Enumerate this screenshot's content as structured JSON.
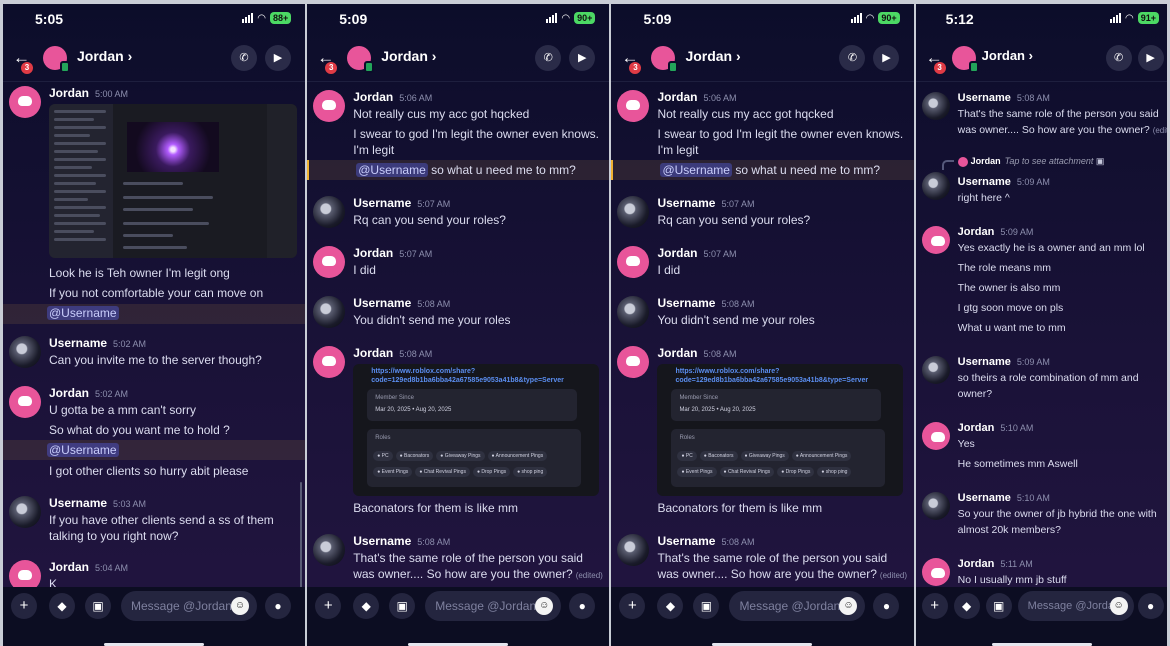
{
  "panels": [
    {
      "status": {
        "time": "5:05",
        "battery": "88+"
      },
      "header": {
        "name": "Jordan",
        "badge": "3"
      },
      "input": {
        "placeholder": "Message @Jordan"
      },
      "messages": [
        {
          "user": "Jordan",
          "time": "5:00 AM",
          "lines": [
            "Look he is Teh owner I'm legit ong",
            "If you not comfortable your can move  on"
          ],
          "mention": "@Username"
        },
        {
          "user": "Username",
          "time": "5:02 AM",
          "lines": [
            "Can you invite me to the server though?"
          ]
        },
        {
          "user": "Jordan",
          "time": "5:02 AM",
          "lines": [
            "U gotta be a mm can't sorry",
            "So what do you want me to hold ?"
          ],
          "mention": "@Username",
          "after": "I got other clients so hurry abit please"
        },
        {
          "user": "Username",
          "time": "5:03 AM",
          "lines": [
            "If you have other clients send a ss of them",
            "talking to you right now?"
          ]
        },
        {
          "user": "Jordan",
          "time": "5:04 AM",
          "lines": [
            "K"
          ]
        }
      ]
    },
    {
      "status": {
        "time": "5:09",
        "battery": "90+"
      },
      "header": {
        "name": "Jordan",
        "badge": "3"
      },
      "input": {
        "placeholder": "Message @Jordan"
      },
      "messages": [
        {
          "user": "Jordan",
          "time": "5:06 AM",
          "lines": [
            "Not really cus my acc got hqcked",
            "I swear to god I'm legit the owner even knows.",
            "I'm legit"
          ],
          "mention": "@Username",
          "mention_tail": " so what u need me to mm?"
        },
        {
          "user": "Username",
          "time": "5:07 AM",
          "lines": [
            "Rq can you send your roles?"
          ]
        },
        {
          "user": "Jordan",
          "time": "5:07 AM",
          "lines": [
            "I did"
          ]
        },
        {
          "user": "Username",
          "time": "5:08 AM",
          "lines": [
            "You didn't send me your roles"
          ]
        },
        {
          "user": "Jordan",
          "time": "5:08 AM",
          "lines": [
            "Baconators for them is like mm"
          ]
        },
        {
          "user": "Username",
          "time": "5:08 AM",
          "lines": [
            "That's the same role of the person you said",
            "was owner.... So how are you the owner?"
          ],
          "edited": "(edited)"
        }
      ]
    },
    {
      "status": {
        "time": "5:09",
        "battery": "90+"
      },
      "header": {
        "name": "Jordan",
        "badge": "3"
      },
      "input": {
        "placeholder": "Message @Jordan"
      },
      "messages": [
        {
          "user": "Jordan",
          "time": "5:06 AM",
          "lines": [
            "Not really cus my acc got hqcked",
            "I swear to god I'm legit the owner even knows.",
            "I'm legit"
          ],
          "mention": "@Username",
          "mention_tail": " so what u need me to mm?"
        },
        {
          "user": "Username",
          "time": "5:07 AM",
          "lines": [
            "Rq can you send your roles?"
          ]
        },
        {
          "user": "Jordan",
          "time": "5:07 AM",
          "lines": [
            "I did"
          ]
        },
        {
          "user": "Username",
          "time": "5:08 AM",
          "lines": [
            "You didn't send me your roles"
          ]
        },
        {
          "user": "Jordan",
          "time": "5:08 AM",
          "lines": [
            "Baconators for them is like mm"
          ]
        },
        {
          "user": "Username",
          "time": "5:08 AM",
          "lines": [
            "That's the same role of the person you said",
            "was owner.... So how are you the owner?"
          ],
          "edited": "(edited)"
        }
      ]
    },
    {
      "status": {
        "time": "5:12",
        "battery": "91+"
      },
      "header": {
        "name": "Jordan",
        "badge": "3"
      },
      "input": {
        "placeholder": "Message @Jordan"
      },
      "messages": [
        {
          "user": "Username",
          "time": "5:08 AM",
          "lines": [
            "That's the same role of the person you said",
            "was owner.... So how are you the owner?"
          ],
          "edited": "(edited)"
        },
        {
          "reply_user": "Jordan",
          "reply_text": "Tap to see attachment",
          "user": "Username",
          "time": "5:09 AM",
          "lines": [
            "right here ^"
          ]
        },
        {
          "user": "Jordan",
          "time": "5:09 AM",
          "lines": [
            "Yes exactly he is a owner and an mm lol",
            "The role means mm",
            "The owner is also mm",
            "I gtg soon move on pls",
            "What u want me to mm"
          ]
        },
        {
          "user": "Username",
          "time": "5:09 AM",
          "lines": [
            "so theirs a role combination of mm and",
            "owner?"
          ]
        },
        {
          "user": "Jordan",
          "time": "5:10 AM",
          "lines": [
            "Yes",
            "He sometimes mm Aswell"
          ]
        },
        {
          "user": "Username",
          "time": "5:10 AM",
          "lines": [
            "So your the owner of jb hybrid the one with",
            "almost 20k members?"
          ]
        },
        {
          "user": "Jordan",
          "time": "5:11 AM",
          "lines": [
            "No I usually  mm jb stuff"
          ]
        }
      ]
    }
  ],
  "roles_card": {
    "link": "https://www.roblox.com/share?code=129ed8b1ba6bba42a67585e9053a41b8&type=Server",
    "member_since_label": "Member Since",
    "member_since_dates": "Mar 20, 2025   •   Aug 20, 2025",
    "roles_label": "Roles",
    "roles": [
      "PC",
      "Baconators",
      "Giveaway Pings",
      "Announcement Pings",
      "Event Pings",
      "Chat Revival Pings",
      "Drop Pings",
      "shop ping"
    ]
  },
  "colors": {
    "accent_pink": "#e8559a",
    "mention_bg": "#3d4484",
    "battery_green": "#4cd964",
    "badge_red": "#e03b45"
  }
}
